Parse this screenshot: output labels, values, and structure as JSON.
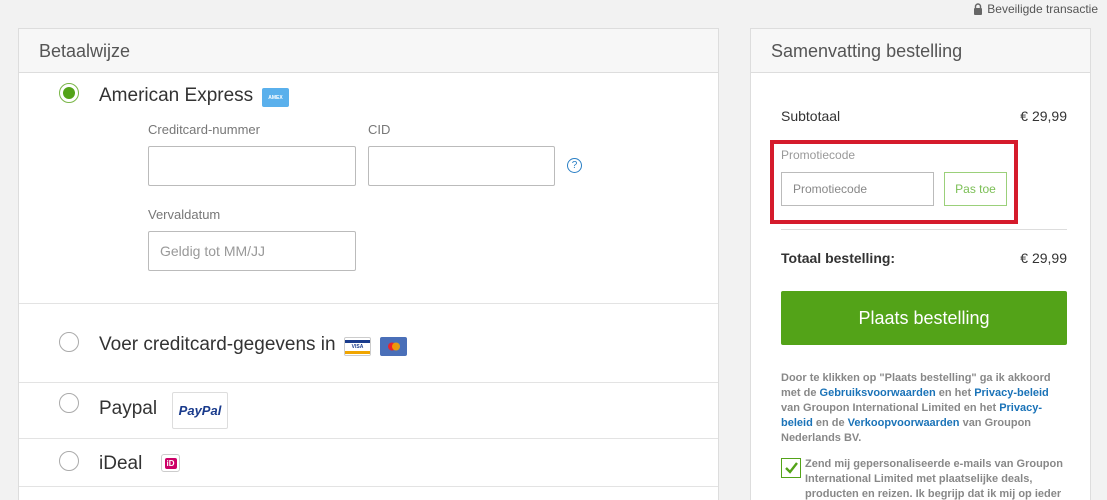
{
  "header": {
    "secure_label": "Beveiligde transactie",
    "secure_icon": "lock-icon"
  },
  "payment": {
    "title": "Betaalwijze",
    "methods": [
      {
        "label": "American Express",
        "selected": true,
        "badges": [
          "AMEX"
        ]
      },
      {
        "label": "Voer creditcard-gegevens in",
        "selected": false,
        "badges": [
          "VISA",
          "mastercard"
        ]
      },
      {
        "label": "Paypal",
        "selected": false,
        "badges": [
          "PayPal"
        ]
      },
      {
        "label": "iDeal",
        "selected": false,
        "badges": [
          "iD"
        ]
      }
    ],
    "card_number_label": "Creditcard-nummer",
    "card_number_value": "",
    "cid_label": "CID",
    "cid_value": "",
    "help_glyph": "?",
    "expiry_label": "Vervaldatum",
    "expiry_placeholder": "Geldig tot MM/JJ",
    "expiry_value": ""
  },
  "summary": {
    "title": "Samenvatting bestelling",
    "subtotal_label": "Subtotaal",
    "subtotal_value": "€ 29,99",
    "promo_label": "Promotiecode",
    "promo_placeholder": "Promotiecode",
    "promo_value": "",
    "apply_label": "Pas toe",
    "total_label": "Totaal bestelling:",
    "total_value": "€ 29,99",
    "order_button": "Plaats bestelling",
    "legal": {
      "t1": "Door te klikken op \"Plaats bestelling\" ga ik akkoord met de ",
      "l1": "Gebruiksvoorwaarden",
      "t2": " en het ",
      "l2": "Privacy-beleid",
      "t3": " van Groupon International Limited en het ",
      "l3": "Privacy-beleid",
      "t4": " en de ",
      "l4": "Verkoopvoorwaarden",
      "t5": " van Groupon Nederlands BV."
    },
    "newsletter_checked": true,
    "newsletter_text": "Zend mij gepersonaliseerde e-mails van Groupon International Limited met plaatselijke deals, producten en reizen. Ik begrijp dat ik mij op ieder"
  },
  "colors": {
    "accent_green": "#53a318",
    "promo_highlight": "#d51b2c",
    "link_blue": "#1a73b8"
  }
}
